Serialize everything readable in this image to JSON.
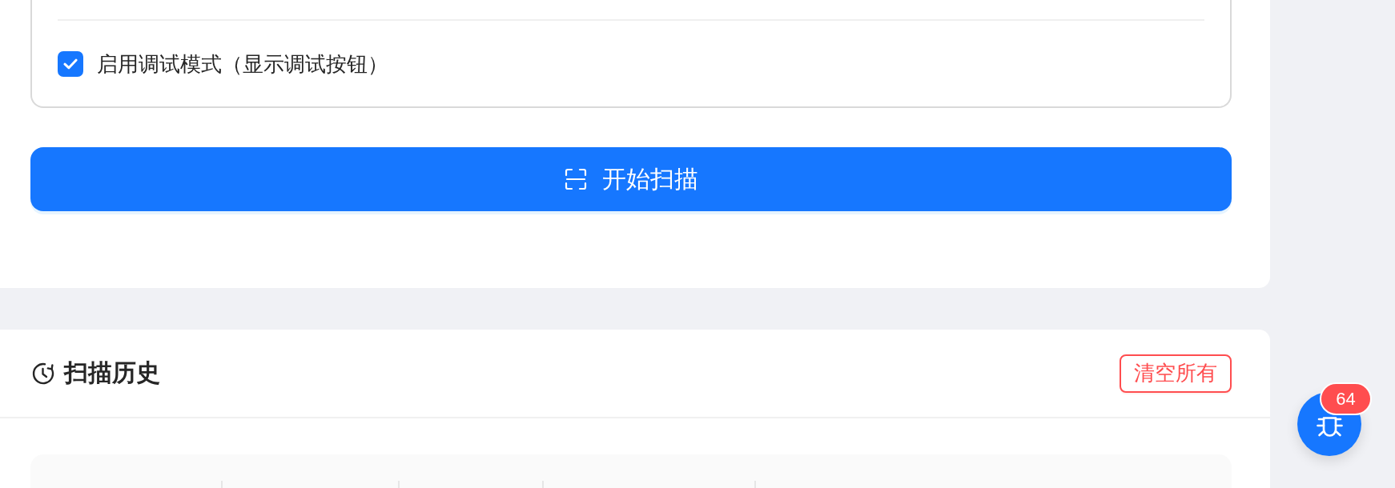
{
  "settings": {
    "debug_mode": {
      "label": "启用调试模式（显示调试按钮）",
      "checked": true
    }
  },
  "scan_button": {
    "label": "开始扫描"
  },
  "history": {
    "title": "扫描历史",
    "clear_button": "清空所有"
  },
  "debug_fab": {
    "badge": "64"
  }
}
